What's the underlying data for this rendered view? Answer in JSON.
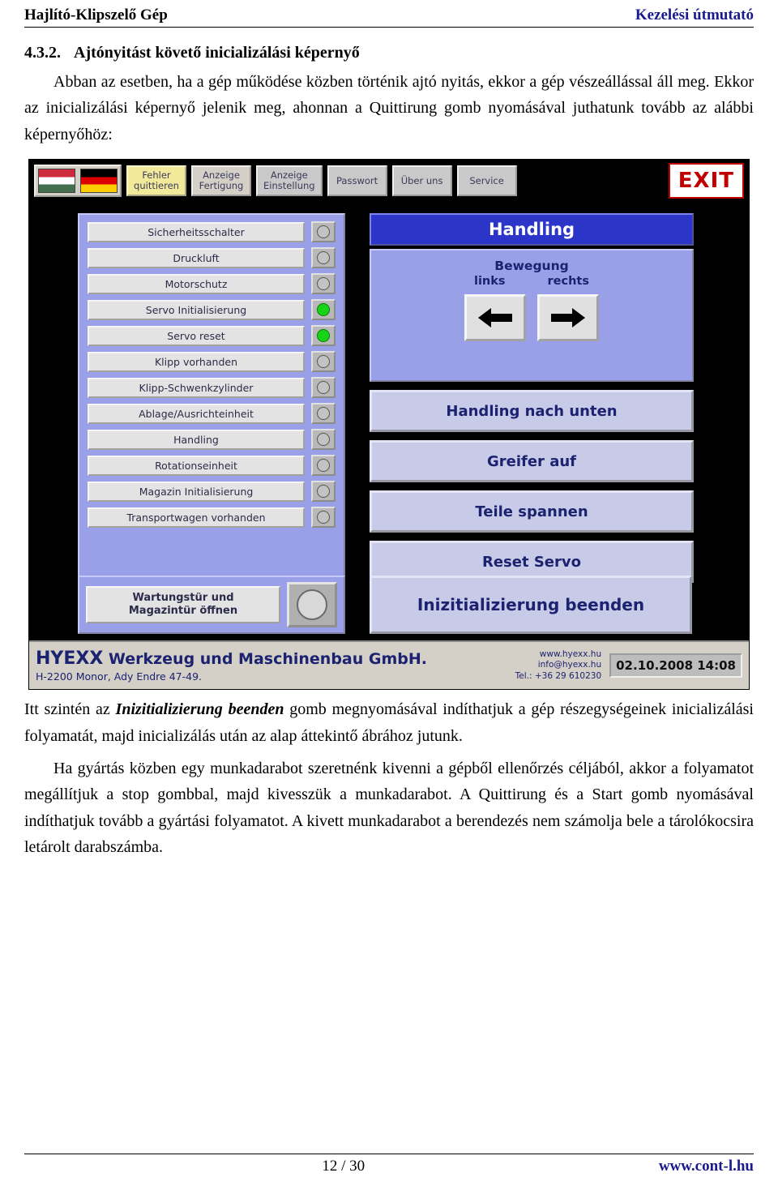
{
  "header": {
    "left": "Hajlító-Klipszelő Gép",
    "right": "Kezelési útmutató"
  },
  "section": {
    "number": "4.3.2.",
    "title": "Ajtónyitást követő inicializálási képernyő",
    "para1": "Abban az esetben, ha a gép működése közben történik ajtó nyitás, ekkor a gép vészeállással áll meg. Ekkor az inicializálási képernyő jelenik meg, ahonnan a Quittirung gomb nyomásával juthatunk tovább az alábbi képernyőhöz:"
  },
  "hmi": {
    "toolbar": [
      {
        "label": "Fehler\nquittieren",
        "style": "yellow"
      },
      {
        "label": "Anzeige\nFertigung",
        "style": "gray"
      },
      {
        "label": "Anzeige\nEinstellung",
        "style": "gray2"
      },
      {
        "label": "Passwort",
        "style": "gray2"
      },
      {
        "label": "Über uns",
        "style": "gray2"
      },
      {
        "label": "Service",
        "style": "gray2"
      }
    ],
    "exit_label": "EXIT",
    "flags": [
      "flag-hungary",
      "flag-germany"
    ],
    "status_rows": [
      {
        "label": "Sicherheitsschalter",
        "lamp": "off"
      },
      {
        "label": "Druckluft",
        "lamp": "off"
      },
      {
        "label": "Motorschutz",
        "lamp": "off"
      },
      {
        "label": "Servo Initialisierung",
        "lamp": "green"
      },
      {
        "label": "Servo reset",
        "lamp": "green"
      },
      {
        "label": "Klipp vorhanden",
        "lamp": "off"
      },
      {
        "label": "Klipp-Schwenkzylinder",
        "lamp": "off"
      },
      {
        "label": "Ablage/Ausrichteinheit",
        "lamp": "off"
      },
      {
        "label": "Handling",
        "lamp": "off"
      },
      {
        "label": "Rotationseinheit",
        "lamp": "off"
      },
      {
        "label": "Magazin Initialisierung",
        "lamp": "off"
      },
      {
        "label": "Transportwagen vorhanden",
        "lamp": "off"
      }
    ],
    "right_title": "Handling",
    "movement_title": "Bewegung",
    "movement_left": "links",
    "movement_right": "rechts",
    "right_buttons": [
      "Handling nach unten",
      "Greifer auf",
      "Teile spannen",
      "Reset Servo"
    ],
    "maintenance_label": "Wartungstür und\nMagazintür öffnen",
    "init_end_label": "Inizitializierung beenden",
    "footer": {
      "brand": "HYEXX",
      "company": "Werkzeug und Maschinenbau GmbH.",
      "address": "H-2200 Monor, Ady Endre 47-49.",
      "web": "www.hyexx.hu",
      "email": "info@hyexx.hu",
      "phone": "Tel.: +36 29 610230",
      "datetime": "02.10.2008 14:08"
    }
  },
  "body": {
    "p2_before": "Itt szintén az ",
    "p2_bold": "Inizitializierung beenden",
    "p2_after": " gomb megnyomásával indíthatjuk a gép részegységeinek inicializálási folyamatát, majd inicializálás után az alap áttekintő ábrához jutunk.",
    "p3": "Ha gyártás közben egy munkadarabot szeretnénk kivenni a gépből ellenőrzés céljából, akkor a folyamatot megállítjuk a stop gombbal, majd kivesszük a munkadarabot. A Quittirung és a Start gomb nyomásával indíthatjuk tovább a gyártási folyamatot. A kivett munkadarabot a berendezés nem számolja bele a tárolókocsira letárolt darabszámba."
  },
  "footer": {
    "page": "12 / 30",
    "site": "www.cont-l.hu"
  }
}
